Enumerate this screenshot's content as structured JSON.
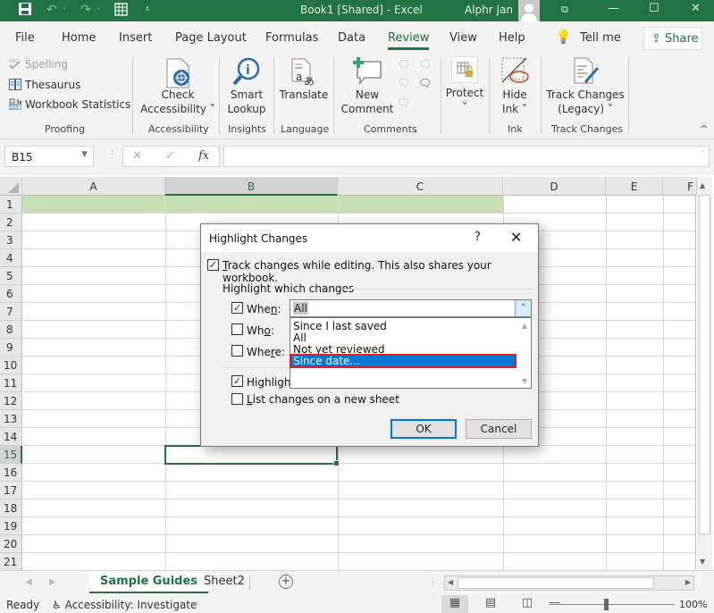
{
  "window": {
    "title": "Book1  [Shared]  -  Excel",
    "user": "Alphr Jan",
    "quick_access": [
      "save-icon",
      "undo-icon",
      "redo-icon",
      "form-icon",
      "customize-icon"
    ],
    "controls": {
      "restore_ribbon": "⧉",
      "minimize": "—",
      "maximize": "☐",
      "close": "✕"
    }
  },
  "menu": {
    "tabs": [
      {
        "label": "File"
      },
      {
        "label": "Home"
      },
      {
        "label": "Insert"
      },
      {
        "label": "Page Layout"
      },
      {
        "label": "Formulas"
      },
      {
        "label": "Data"
      },
      {
        "label": "Review",
        "active": true
      },
      {
        "label": "View"
      },
      {
        "label": "Help"
      }
    ],
    "tell_me": "Tell me",
    "share": "Share"
  },
  "ribbon": {
    "proofing": {
      "spelling": "Spelling",
      "thesaurus": "Thesaurus",
      "workbook_statistics": "Workbook Statistics",
      "group": "Proofing"
    },
    "accessibility": {
      "line1": "Check",
      "line2": "Accessibility ˅",
      "group": "Accessibility"
    },
    "insights": {
      "line1": "Smart",
      "line2": "Lookup",
      "group": "Insights"
    },
    "language": {
      "line1": "Translate",
      "group": "Language"
    },
    "comments": {
      "line1": "New",
      "line2": "Comment",
      "group": "Comments"
    },
    "protect": {
      "line1": "Protect",
      "line2": "˅"
    },
    "ink": {
      "line1": "Hide",
      "line2": "Ink ˅",
      "group": "Ink"
    },
    "track_changes": {
      "line1": "Track Changes",
      "line2": "(Legacy) ˅",
      "group": "Track Changes"
    },
    "collapse": "^"
  },
  "formula_bar": {
    "name_box": "B15",
    "cancel": "✕",
    "enter": "✓",
    "fx": "fx",
    "value": ""
  },
  "sheet": {
    "columns": [
      "A",
      "B",
      "C",
      "D",
      "E",
      "F"
    ],
    "selected_column": "B",
    "rows": [
      "1",
      "2",
      "3",
      "4",
      "5",
      "6",
      "7",
      "8",
      "9",
      "10",
      "11",
      "12",
      "13",
      "14",
      "15",
      "16",
      "17",
      "18",
      "19",
      "20",
      "21"
    ],
    "selected_row": "15",
    "active_cell": "B15",
    "row1_fill": "#c6e0b4"
  },
  "sheet_tabs": {
    "tabs": [
      {
        "label": "Sample Guides",
        "active": true
      },
      {
        "label": "Sheet2"
      }
    ],
    "add": "+"
  },
  "status": {
    "ready": "Ready",
    "accessibility": "Accessibility: Investigate",
    "zoom": "100%"
  },
  "dialog": {
    "title": "Highlight Changes",
    "help": "?",
    "close": "✕",
    "track_changes": {
      "label_u": "T",
      "label_rest": "rack changes while editing. This also shares your workbook.",
      "checked": true
    },
    "group_header": "Highlight which changes",
    "when": {
      "label_pre": "Whe",
      "label_u": "n",
      "label_post": ":",
      "checked": true,
      "value": "All"
    },
    "who": {
      "label_pre": "Wh",
      "label_u": "o",
      "label_post": ":",
      "checked": false
    },
    "where": {
      "label_pre": "Whe",
      "label_u": "r",
      "label_post": "e:",
      "checked": false
    },
    "dropdown_options": [
      "Since I last saved",
      "All",
      "Not yet reviewed",
      "Since date..."
    ],
    "dropdown_selected": "Since date...",
    "highlight_on_screen": {
      "label": "Highlight",
      "checked": true
    },
    "list_changes": {
      "label_u": "L",
      "label_rest": "ist changes on a new sheet",
      "checked": false
    },
    "ok": "OK",
    "cancel": "Cancel"
  },
  "colors": {
    "excel_green": "#217346",
    "selection_blue": "#0078d7",
    "highlight_red": "#e01e2a"
  }
}
